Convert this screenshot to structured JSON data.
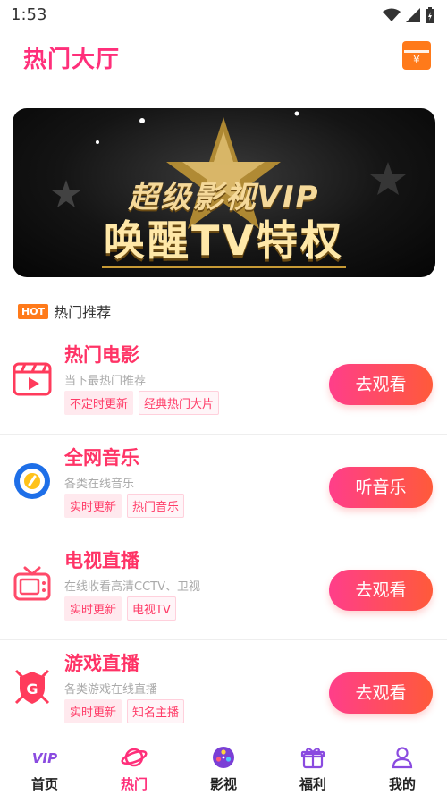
{
  "status_bar": {
    "time": "1:53"
  },
  "header": {
    "title": "热门大厅"
  },
  "banner": {
    "line1": "超级影视VIP",
    "line2": "唤醒TV特权"
  },
  "hot_section": {
    "badge": "HOT",
    "label": "热门推荐"
  },
  "items": [
    {
      "name": "热门电影",
      "desc": "当下最热门推荐",
      "tags": [
        "不定时更新",
        "经典热门大片"
      ],
      "button": "去观看"
    },
    {
      "name": "全网音乐",
      "desc": "各类在线音乐",
      "tags": [
        "实时更新",
        "热门音乐"
      ],
      "button": "听音乐"
    },
    {
      "name": "电视直播",
      "desc": "在线收看高清CCTV、卫视",
      "tags": [
        "实时更新",
        "电视TV"
      ],
      "button": "去观看"
    },
    {
      "name": "游戏直播",
      "desc": "各类游戏在线直播",
      "tags": [
        "实时更新",
        "知名主播"
      ],
      "button": "去观看"
    }
  ],
  "tabbar": {
    "tabs": [
      {
        "label": "首页",
        "icon": "vip-icon"
      },
      {
        "label": "热门",
        "icon": "planet-icon"
      },
      {
        "label": "影视",
        "icon": "film-reel-icon"
      },
      {
        "label": "福利",
        "icon": "gift-icon"
      },
      {
        "label": "我的",
        "icon": "user-icon"
      }
    ],
    "active_index": 1
  },
  "colors": {
    "accent": "#ff2f7a",
    "button_start": "#ff3e8a",
    "button_end": "#ff5a3a",
    "hot_badge": "#ff7a1a"
  }
}
